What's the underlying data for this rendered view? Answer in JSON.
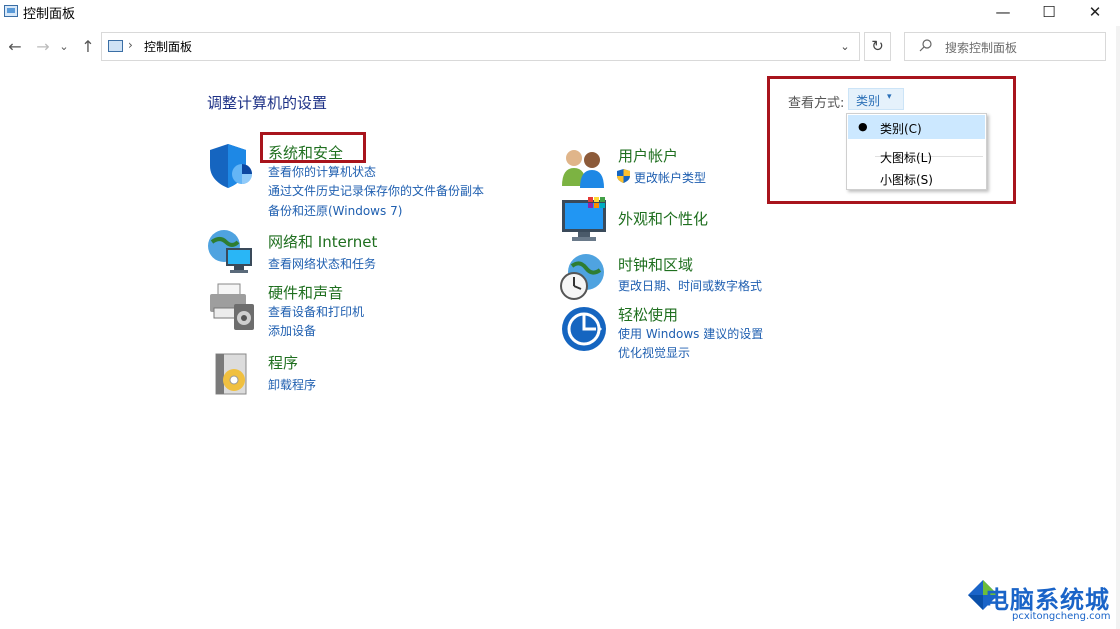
{
  "window": {
    "title": "控制面板",
    "minimize_glyph": "—",
    "maximize_glyph": "☐",
    "close_glyph": "✕"
  },
  "nav": {
    "back_glyph": "←",
    "forward_glyph": "→",
    "recent_glyph": "⌄",
    "up_glyph": "↑"
  },
  "address": {
    "separator": "›",
    "path": "控制面板",
    "dropdown_glyph": "⌄",
    "refresh_glyph": "↻"
  },
  "search": {
    "placeholder": "搜索控制面板",
    "icon": "search-icon"
  },
  "main": {
    "title": "调整计算机的设置",
    "view_by": {
      "label": "查看方式:",
      "value": "类别",
      "caret": "▾",
      "options": [
        {
          "label": "类别(C)",
          "selected": true
        },
        {
          "label": "大图标(L)",
          "selected": false
        },
        {
          "label": "小图标(S)",
          "selected": false
        }
      ],
      "selected_bullet": "●"
    },
    "categories_left": [
      {
        "title": "系统和安全",
        "icon": "shield-icon",
        "links": [
          "查看你的计算机状态",
          "通过文件历史记录保存你的文件备份副本",
          "备份和还原(Windows 7)"
        ]
      },
      {
        "title": "网络和 Internet",
        "icon": "network-globe-icon",
        "links": [
          "查看网络状态和任务"
        ]
      },
      {
        "title": "硬件和声音",
        "icon": "printer-speaker-icon",
        "links": [
          "查看设备和打印机",
          "添加设备"
        ]
      },
      {
        "title": "程序",
        "icon": "programs-disc-icon",
        "links": [
          "卸载程序"
        ]
      }
    ],
    "categories_right": [
      {
        "title": "用户帐户",
        "icon": "users-icon",
        "links": [
          "更改帐户类型"
        ]
      },
      {
        "title": "外观和个性化",
        "icon": "monitor-palette-icon",
        "links": []
      },
      {
        "title": "时钟和区域",
        "icon": "clock-globe-icon",
        "links": [
          "更改日期、时间或数字格式"
        ]
      },
      {
        "title": "轻松使用",
        "icon": "ease-of-access-icon",
        "links": [
          "使用 Windows 建议的设置",
          "优化视觉显示"
        ]
      }
    ]
  },
  "watermark": {
    "text": "电脑系统城",
    "sub": "pcxitongcheng.com"
  },
  "colors": {
    "highlight_box": "#a8141c",
    "category_title": "#1f6f1f",
    "link": "#1f5fb0",
    "heading": "#1e3287"
  }
}
